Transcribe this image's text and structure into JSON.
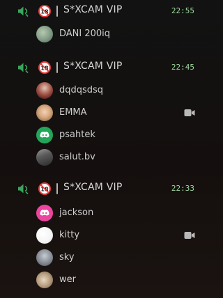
{
  "channels": [
    {
      "name": "S*XCAM VIP",
      "time": "22:55",
      "members": [
        {
          "name": "DANI 200iq",
          "avatar": "photo-light-green",
          "video": false
        }
      ]
    },
    {
      "name": "S*XCAM VIP",
      "time": "22:45",
      "members": [
        {
          "name": "dqdqsdsq",
          "avatar": "photo-person-red",
          "video": false
        },
        {
          "name": "EMMA",
          "avatar": "photo-blonde",
          "video": true
        },
        {
          "name": "psahtek",
          "avatar": "discord-green",
          "video": false
        },
        {
          "name": "salut.bv",
          "avatar": "photo-dark",
          "video": false
        }
      ]
    },
    {
      "name": "S*XCAM VIP",
      "time": "22:33",
      "members": [
        {
          "name": "jackson",
          "avatar": "discord-pink",
          "video": false
        },
        {
          "name": "kitty",
          "avatar": "photo-white",
          "video": true
        },
        {
          "name": "sky",
          "avatar": "photo-grey",
          "video": false
        },
        {
          "name": "wer",
          "avatar": "photo-beige",
          "video": false
        }
      ]
    }
  ],
  "colors": {
    "voice_icon": "#3ba55c",
    "age_badge": "#e53935",
    "time": "#9fd89f",
    "discord_green": "#23a559",
    "discord_pink": "#eb459e"
  },
  "icons": {
    "voice": "speaker-icon",
    "age": "18-plus-icon",
    "video": "video-camera-icon"
  }
}
